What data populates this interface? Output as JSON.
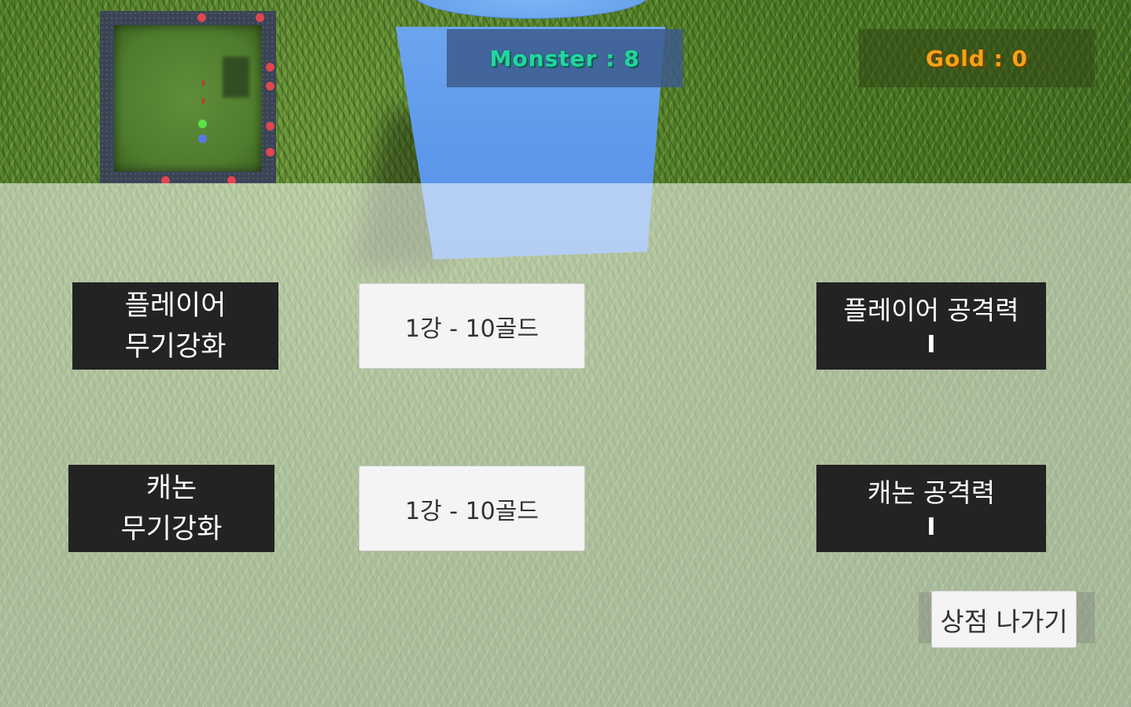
{
  "hud": {
    "monster_text": "Monster : 8",
    "gold_text": "Gold : 0",
    "monster_color": "#22d6a0",
    "gold_color": "#f5a318"
  },
  "minimap": {
    "dots": [
      "red-enemy",
      "green-player",
      "blue-cannon"
    ]
  },
  "shop": {
    "player_weapon": {
      "label_line1": "플레이어",
      "label_line2": "무기강화",
      "buy_button": "1강 - 10골드",
      "stat_title": "플레이어 공격력",
      "stat_value": "I"
    },
    "cannon_weapon": {
      "label_line1": "캐논",
      "label_line2": "무기강화",
      "buy_button": "1강 - 10골드",
      "stat_title": "캐논 공격력",
      "stat_value": "I"
    },
    "exit_button": "상점 나가기"
  },
  "colors": {
    "panel_dark": "#232323",
    "button_light": "#f4f4f4",
    "cube_blue": "#5d98ea"
  }
}
